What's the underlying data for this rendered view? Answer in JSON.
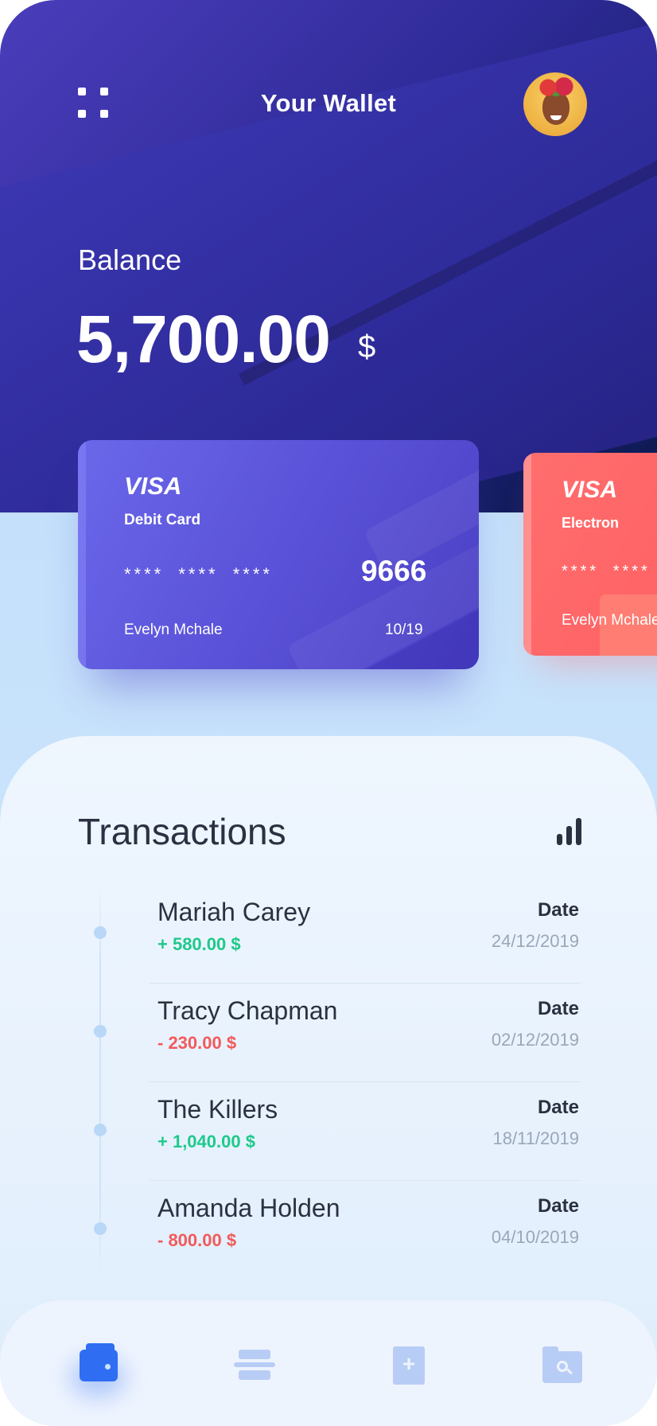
{
  "header": {
    "title": "Your Wallet"
  },
  "balance": {
    "label": "Balance",
    "amount": "5,700.00",
    "currency": "$"
  },
  "cards": [
    {
      "brand": "VISA",
      "type": "Debit Card",
      "masked": "**** **** ****",
      "last4": "9666",
      "holder": "Evelyn Mchale",
      "expiry": "10/19",
      "color": "#5a52d8"
    },
    {
      "brand": "VISA",
      "type": "Electron",
      "masked": "**** ****",
      "holder": "Evelyn Mchale",
      "color": "#ff6466"
    }
  ],
  "transactions": {
    "title": "Transactions",
    "items": [
      {
        "name": "Mariah Carey",
        "amount": "+ 580.00 $",
        "date_label": "Date",
        "date": "24/12/2019"
      },
      {
        "name": "Tracy Chapman",
        "amount": "- 230.00 $",
        "date_label": "Date",
        "date": "02/12/2019"
      },
      {
        "name": "The Killers",
        "amount": "+ 1,040.00 $",
        "date_label": "Date",
        "date": "18/11/2019"
      },
      {
        "name": "Amanda Holden",
        "amount": "- 800.00 $",
        "date_label": "Date",
        "date": "04/10/2019"
      }
    ]
  },
  "colors": {
    "positive": "#1ec98a",
    "negative": "#f25a5a",
    "accent": "#2f6ef3"
  },
  "icons": {
    "menu": "menu-grid-icon",
    "stats": "bar-chart-icon",
    "nav": [
      "wallet-icon",
      "cards-icon",
      "add-icon",
      "folder-search-icon"
    ]
  }
}
